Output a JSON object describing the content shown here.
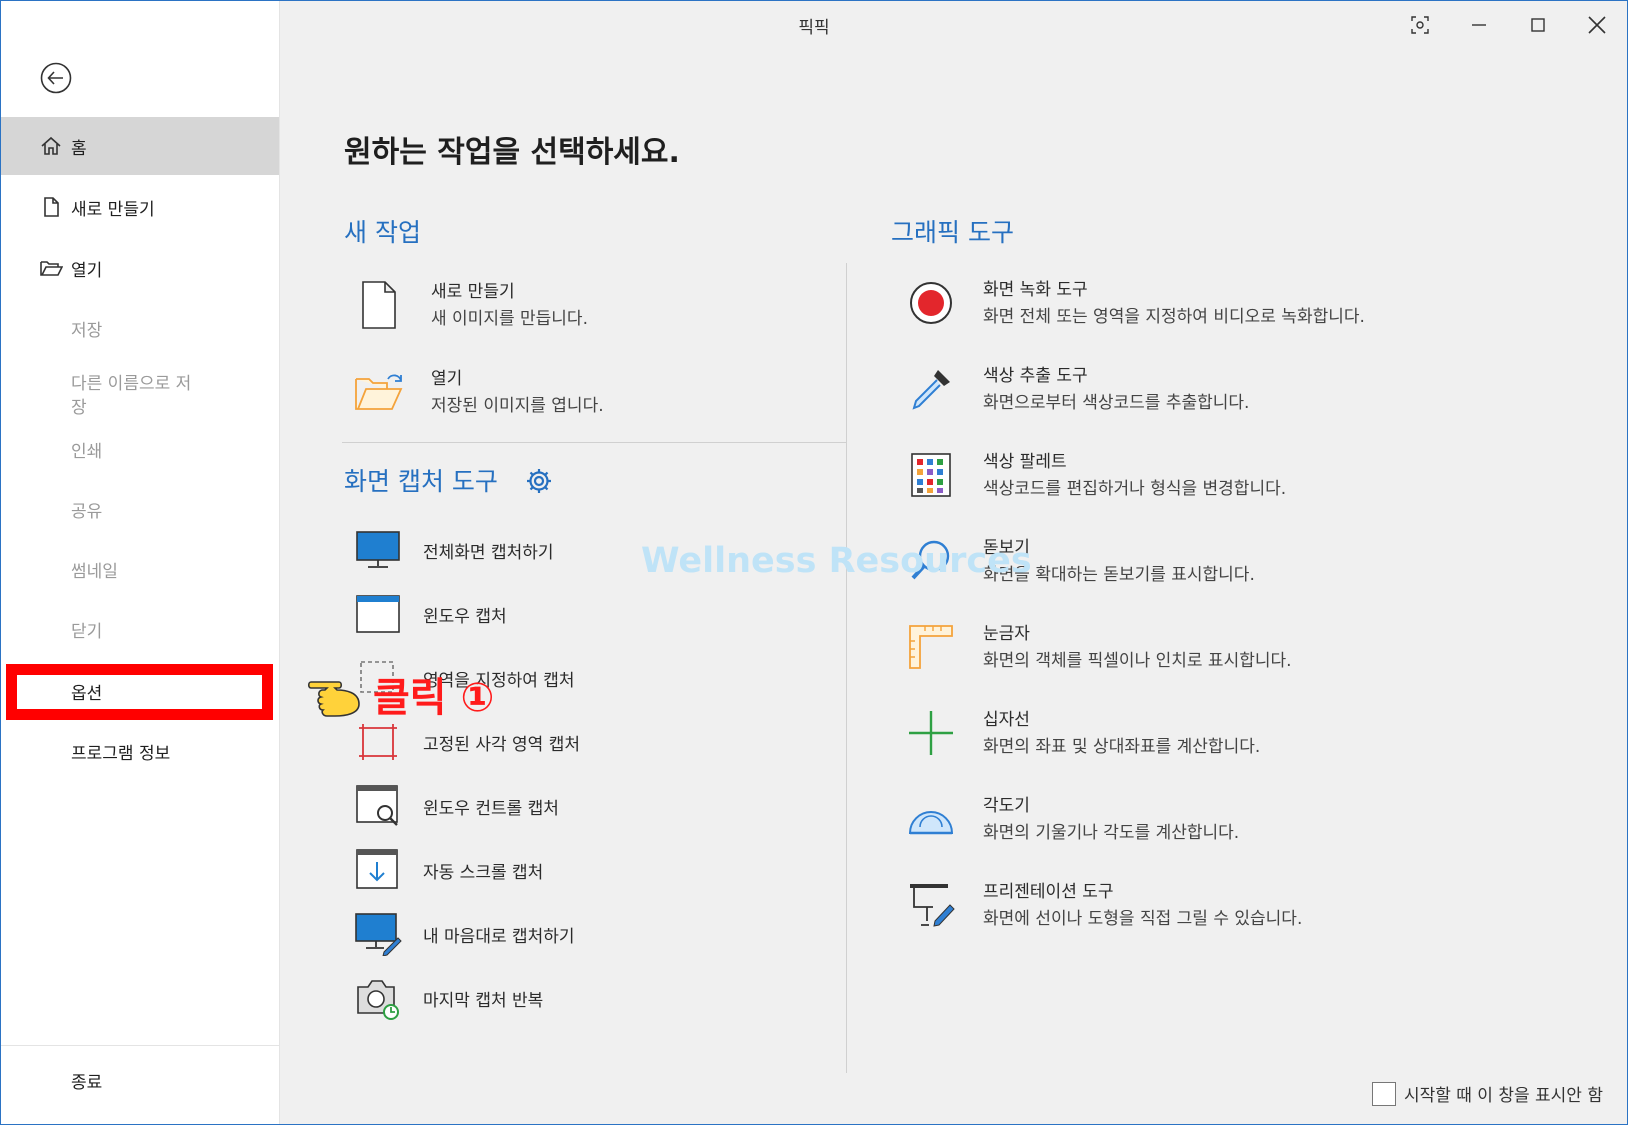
{
  "window": {
    "title": "픽픽"
  },
  "sidebar": {
    "home": "홈",
    "new": "새로 만들기",
    "open": "열기",
    "save": "저장",
    "save_as": "다른 이름으로 저\n장",
    "print": "인쇄",
    "share": "공유",
    "thumbnail": "썸네일",
    "close": "닫기",
    "options": "옵션",
    "about": "프로그램 정보",
    "exit": "종료"
  },
  "main": {
    "heading": "원하는 작업을 선택하세요.",
    "new_task": {
      "header": "새 작업",
      "new_title": "새로 만들기",
      "new_desc": "새 이미지를 만듭니다.",
      "open_title": "열기",
      "open_desc": "저장된 이미지를 엽니다."
    },
    "capture": {
      "header": "화면 캡처 도구",
      "items": [
        "전체화면 캡처하기",
        "윈도우 캡처",
        "영역을 지정하여 캡처",
        "고정된 사각 영역 캡처",
        "윈도우 컨트롤 캡처",
        "자동 스크롤 캡처",
        "내 마음대로 캡처하기",
        "마지막 캡처 반복"
      ]
    },
    "graphic": {
      "header": "그래픽 도구",
      "items": [
        {
          "title": "화면 녹화 도구",
          "desc": "화면 전체 또는 영역을 지정하여 비디오로 녹화합니다."
        },
        {
          "title": "색상 추출 도구",
          "desc": "화면으로부터 색상코드를 추출합니다."
        },
        {
          "title": "색상 팔레트",
          "desc": "색상코드를 편집하거나 형식을 변경합니다."
        },
        {
          "title": "돋보기",
          "desc": "화면을 확대하는 돋보기를 표시합니다."
        },
        {
          "title": "눈금자",
          "desc": "화면의 객체를 픽셀이나 인치로 표시합니다."
        },
        {
          "title": "십자선",
          "desc": "화면의 좌표 및 상대좌표를 계산합니다."
        },
        {
          "title": "각도기",
          "desc": "화면의 기울기나 각도를 계산합니다."
        },
        {
          "title": "프리젠테이션 도구",
          "desc": "화면에 선이나 도형을 직접 그릴 수 있습니다."
        }
      ]
    }
  },
  "footer": {
    "startup_label": "시작할 때 이 창을 표시안 함"
  },
  "overlay": {
    "watermark": "Wellness Resources",
    "click_annotation": "클릭 ①"
  },
  "colors": {
    "accent": "#2670c0",
    "highlight": "#ff0000"
  }
}
